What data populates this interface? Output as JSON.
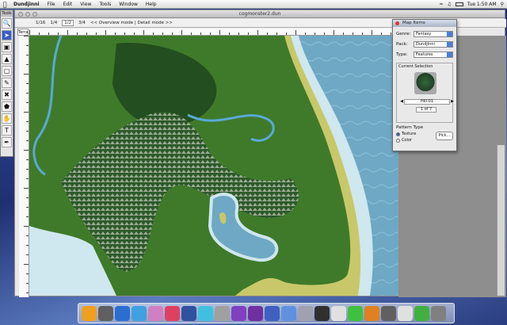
{
  "menubar": {
    "app_name": "Dundjinni",
    "items": [
      "File",
      "Edit",
      "View",
      "Tools",
      "Window",
      "Help"
    ],
    "clock": "Tue 1:50 AM"
  },
  "window": {
    "title": "cogmonster2.dun",
    "modes": [
      "1/16",
      "1/4",
      "1/2",
      "3/4",
      "<< Overview mode | Detail mode >>"
    ],
    "active_mode": "1/2",
    "left_tab": "Terra"
  },
  "toolbox": {
    "title": "Tools"
  },
  "panel": {
    "title": "Map Items",
    "genre_label": "Genre:",
    "genre_value": "Fantasy",
    "pack_label": "Pack:",
    "pack_value": "Dundjinni",
    "type_label": "Type:",
    "type_value": "Features",
    "current_selection_label": "Current Selection",
    "item_name": "Hill-01",
    "item_count": "1 of 7",
    "pattern_type_label": "Pattern Type",
    "texture_label": "Texture",
    "color_label": "Color",
    "pick_label": "Pick..."
  },
  "colors": {
    "land": "#3f7a2a",
    "forest": "#234e1f",
    "shallow_water": "#cfe7ee",
    "deep_water": "#6ea8c4",
    "beach": "#c8c86a",
    "river": "#5aa9d6"
  },
  "dock": {
    "icon_colors": [
      "#f0a020",
      "#606060",
      "#2a6ed0",
      "#40a0e0",
      "#d080c0",
      "#e04060",
      "#3050a0",
      "#40c0e0",
      "#a0a0a0",
      "#8040c0",
      "#7030a0",
      "#4060c0",
      "#6090e0",
      "#a0a0b0",
      "#303030",
      "#e0e0e0",
      "#40c040",
      "#e08020",
      "#606060",
      "#e0e0e0",
      "#40b040",
      "#808080"
    ]
  }
}
